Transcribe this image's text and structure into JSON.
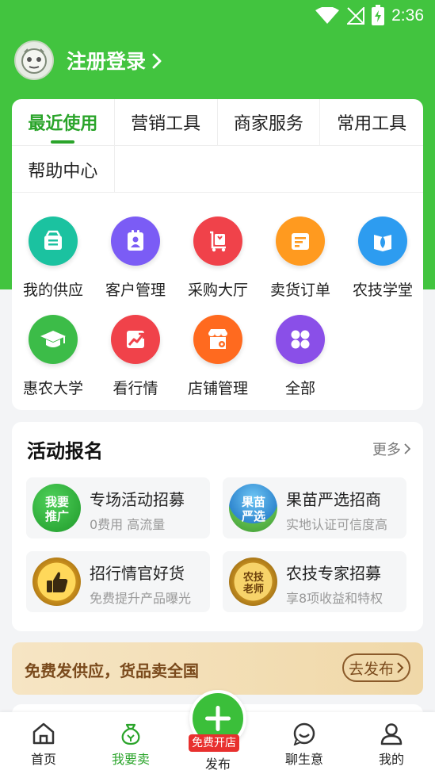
{
  "status": {
    "time": "2:36"
  },
  "profile": {
    "login_label": "注册登录"
  },
  "tabs": [
    {
      "label": "最近使用",
      "active": true
    },
    {
      "label": "营销工具"
    },
    {
      "label": "商家服务"
    },
    {
      "label": "常用工具"
    },
    {
      "label": "帮助中心"
    }
  ],
  "tools": [
    {
      "label": "我的供应",
      "icon": "store-box-icon",
      "color": "#1bc2a0"
    },
    {
      "label": "客户管理",
      "icon": "contact-card-icon",
      "color": "#7b5cf5"
    },
    {
      "label": "采购大厅",
      "icon": "purchase-cart-icon",
      "color": "#f0424a"
    },
    {
      "label": "卖货订单",
      "icon": "order-list-icon",
      "color": "#ff9a1f"
    },
    {
      "label": "农技学堂",
      "icon": "leaf-book-icon",
      "color": "#2d9cf0"
    },
    {
      "label": "惠农大学",
      "icon": "graduation-cap-icon",
      "color": "#3cbc48"
    },
    {
      "label": "看行情",
      "icon": "trend-chart-icon",
      "color": "#f0424a"
    },
    {
      "label": "店铺管理",
      "icon": "shop-gear-icon",
      "color": "#ff6a1f"
    },
    {
      "label": "全部",
      "icon": "all-grid-icon",
      "color": "#8a4fe8"
    }
  ],
  "activity": {
    "title": "活动报名",
    "more_label": "更多",
    "items": [
      {
        "title": "专场活动招募",
        "subtitle": "0费用 高流量",
        "badge": "我要推广",
        "icon": "promote-badge-icon"
      },
      {
        "title": "果苗严选招商",
        "subtitle": "实地认证可信度高",
        "badge": "果苗严选",
        "icon": "seedling-badge-icon"
      },
      {
        "title": "招行情官好货",
        "subtitle": "免费提升产品曝光",
        "badge": "",
        "icon": "thumbs-up-badge-icon"
      },
      {
        "title": "农技专家招募",
        "subtitle": "享8项收益和特权",
        "badge": "农技老师",
        "icon": "expert-badge-icon"
      }
    ]
  },
  "banner": {
    "text": "免费发供应，货品卖全国",
    "button": "去发布"
  },
  "nav": [
    {
      "label": "首页",
      "icon": "home-icon"
    },
    {
      "label": "我要卖",
      "icon": "sell-bag-icon",
      "active": true
    },
    {
      "label": "发布",
      "icon": "plus-icon",
      "badge": "免费开店"
    },
    {
      "label": "聊生意",
      "icon": "chat-smile-icon"
    },
    {
      "label": "我的",
      "icon": "user-icon"
    }
  ]
}
